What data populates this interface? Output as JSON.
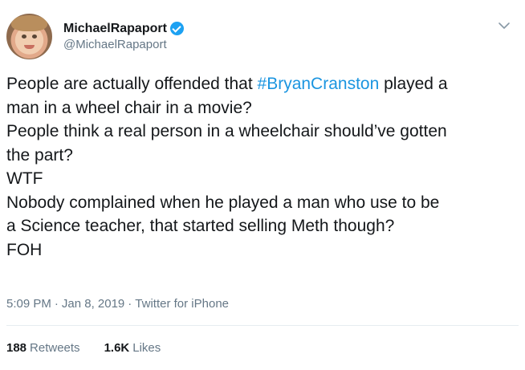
{
  "user": {
    "display_name": "MichaelRapaport",
    "handle": "@MichaelRapaport",
    "verified": true
  },
  "tweet": {
    "line1_before": "People are actually offended that ",
    "line1_hashtag": "#BryanCranston",
    "line1_after": " played a",
    "line2": "man in a wheel chair in a movie?",
    "line3": "People think a real person in a wheelchair should’ve gotten",
    "line4": "the part?",
    "line5": "WTF",
    "line6": "Nobody complained when he played a man who use to be",
    "line7": "a Science teacher, that started selling Meth though?",
    "line8": "FOH"
  },
  "meta": {
    "time": "5:09 PM",
    "sep1": "·",
    "date": "Jan 8, 2019",
    "sep2": "·",
    "source": "Twitter for iPhone"
  },
  "stats": {
    "retweets_count": "188",
    "retweets_label": "Retweets",
    "likes_count": "1.6K",
    "likes_label": "Likes"
  },
  "colors": {
    "hashtag": "#1b95e0",
    "verified_badge": "#1da1f2",
    "secondary_text": "#657786"
  },
  "icons": [
    "verified-badge-icon",
    "chevron-down-icon"
  ]
}
